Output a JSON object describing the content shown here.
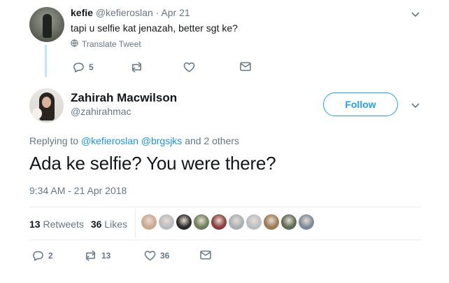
{
  "parent_tweet": {
    "display_name": "kefie",
    "handle": "@kefieroslan",
    "separator": "·",
    "date": "Apr 21",
    "text": "tapi u selfie kat jenazah, better sgt ke?",
    "translate_label": "Translate Tweet",
    "actions": {
      "reply_count": "5",
      "retweet_count": "",
      "like_count": ""
    }
  },
  "main_tweet": {
    "display_name": "Zahirah Macwilson",
    "handle": "@zahirahmac",
    "follow_label": "Follow",
    "replying_prefix": "Replying to",
    "replying_user1": "@kefieroslan",
    "replying_user2": "@brgsjks",
    "replying_suffix": "and 2 others",
    "text": "Ada ke selfie? You were there?",
    "timestamp": "9:34 AM - 21 Apr 2018",
    "retweets_count": "13",
    "retweets_label": "Retweets",
    "likes_count": "36",
    "likes_label": "Likes",
    "likers": [
      "#c9a98f",
      "#b7bcc1",
      "#2b2b2b",
      "#6c7f58",
      "#8b3d3d",
      "#a8b0b6",
      "#b9bec3",
      "#9b7a52",
      "#5e6b55",
      "#7d8a99"
    ],
    "actions": {
      "reply_count": "2",
      "retweet_count": "13",
      "like_count": "36"
    }
  },
  "colors": {
    "accent": "#1da1f2",
    "link": "#1b95e0",
    "muted": "#657786",
    "thread": "#c4e4f8"
  }
}
